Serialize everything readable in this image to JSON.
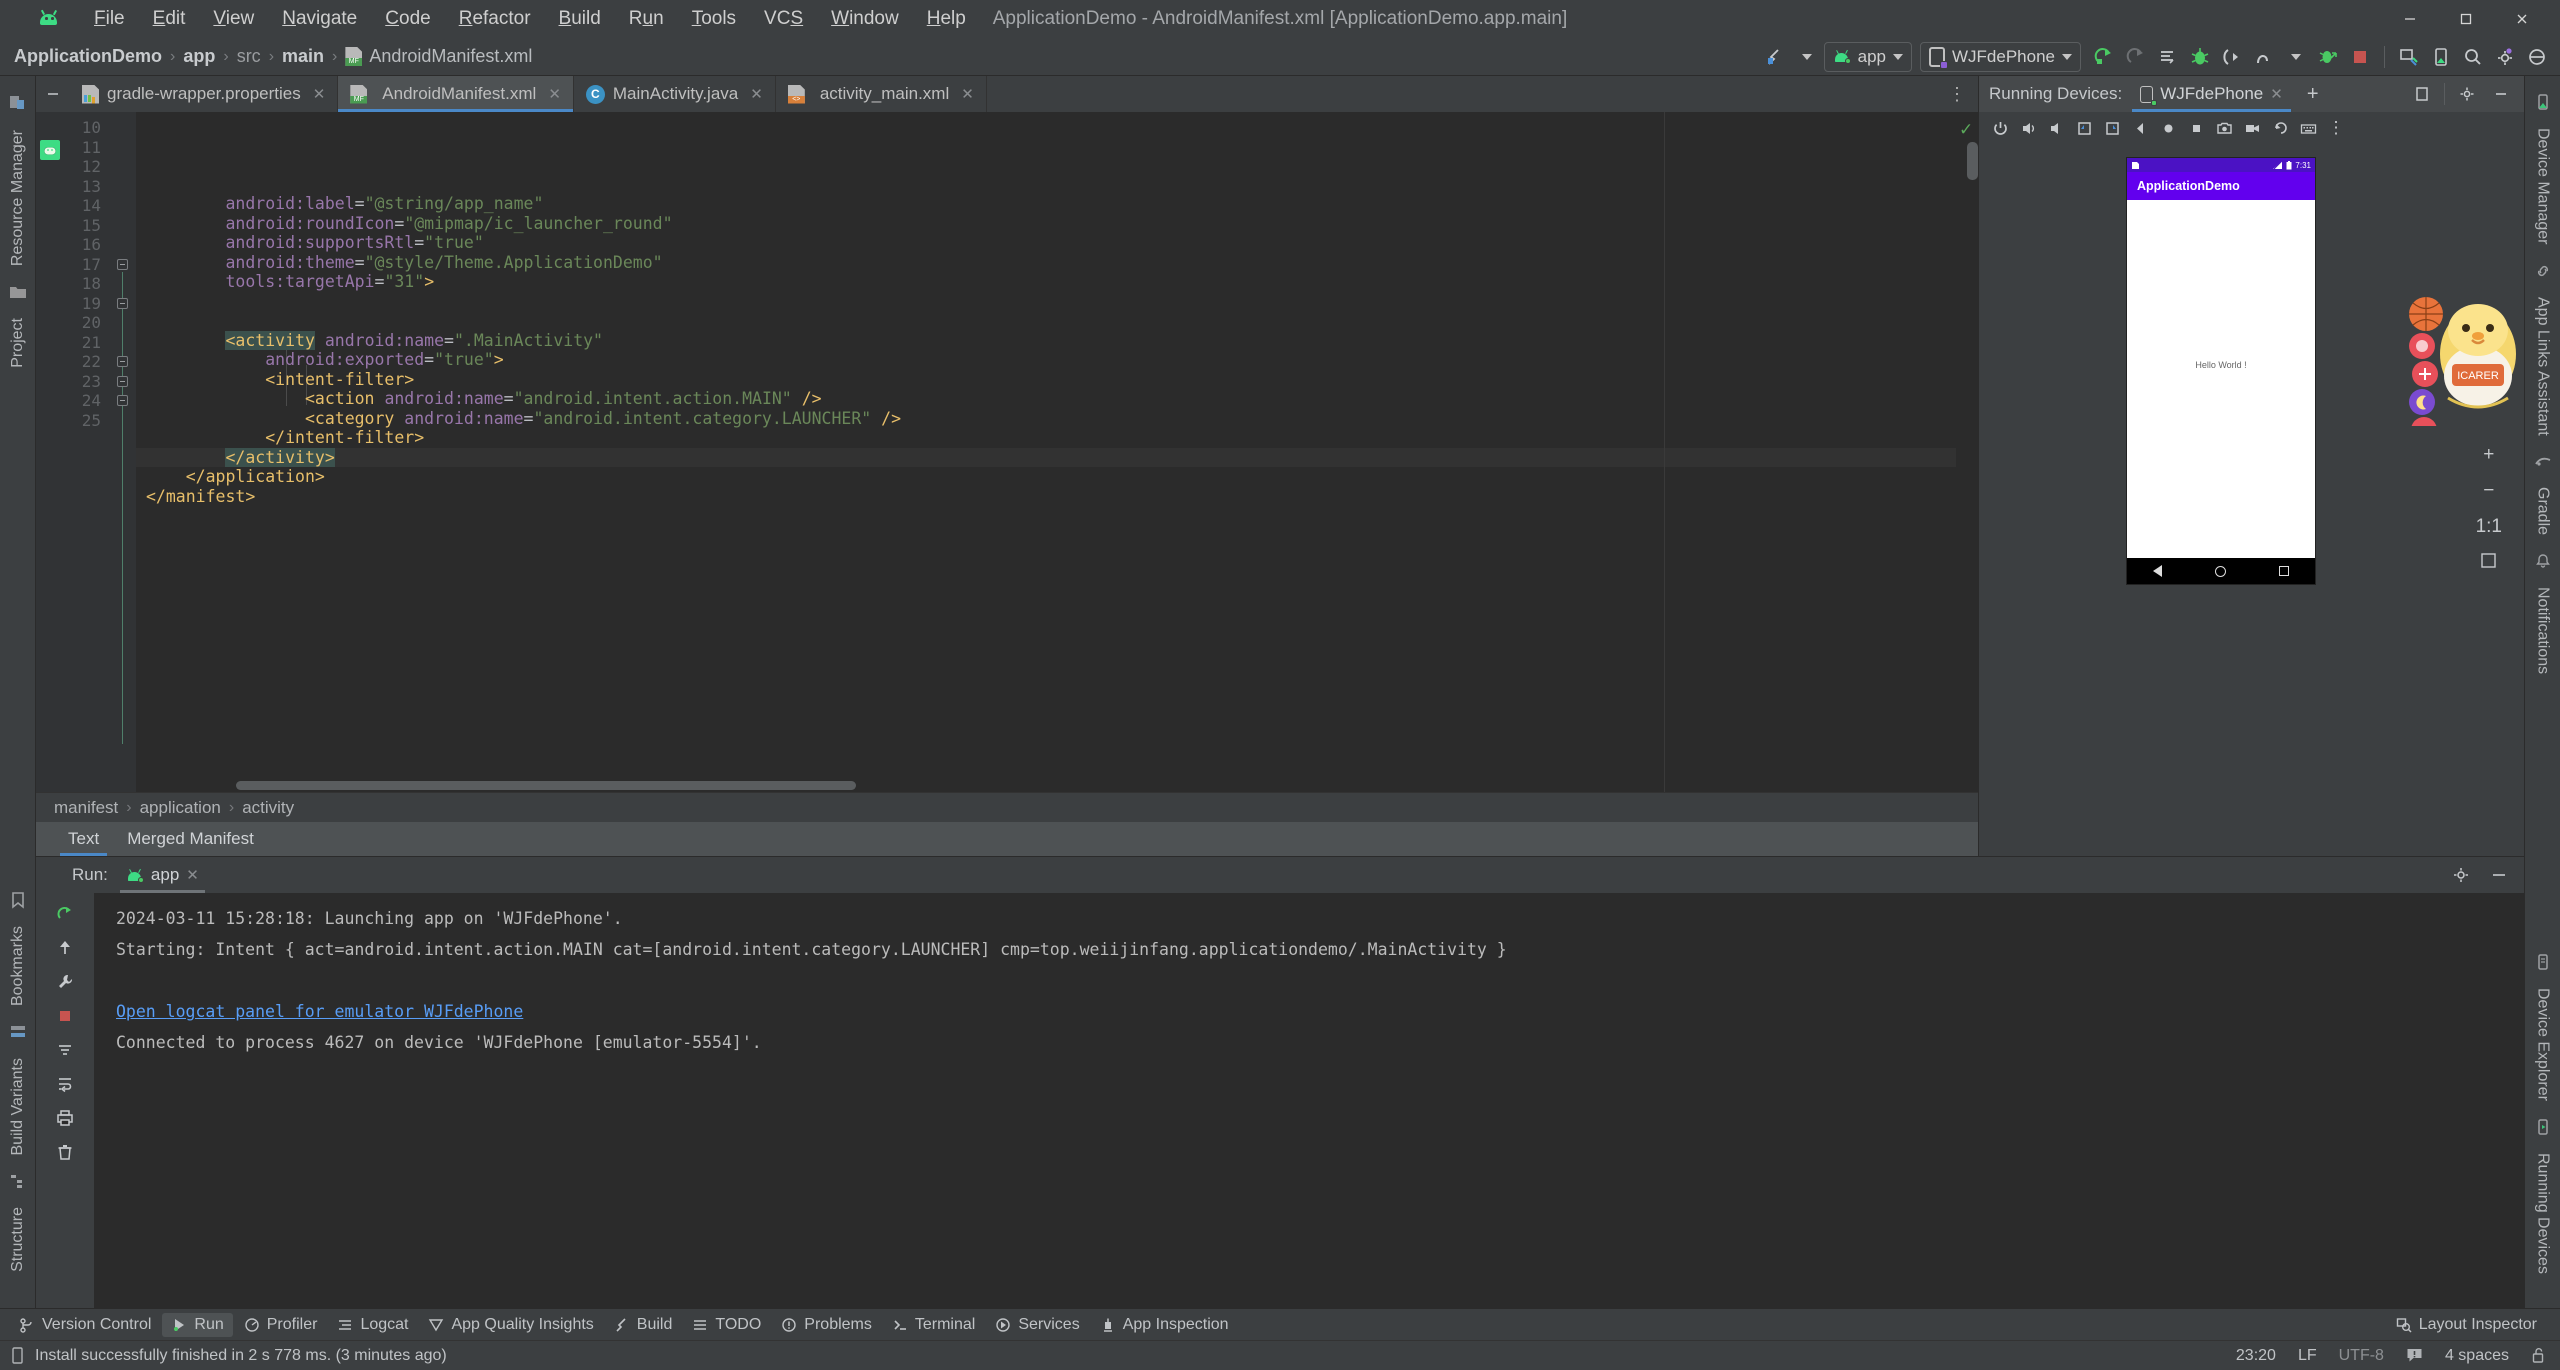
{
  "window": {
    "title": "ApplicationDemo - AndroidManifest.xml [ApplicationDemo.app.main]",
    "minimize": "—",
    "maximize": "❐",
    "close": "✕"
  },
  "menubar": {
    "items": [
      {
        "label": "File",
        "mnemonic": "F"
      },
      {
        "label": "Edit",
        "mnemonic": "E"
      },
      {
        "label": "View",
        "mnemonic": "V"
      },
      {
        "label": "Navigate",
        "mnemonic": "N"
      },
      {
        "label": "Code",
        "mnemonic": "C"
      },
      {
        "label": "Refactor",
        "mnemonic": "R"
      },
      {
        "label": "Build",
        "mnemonic": "B"
      },
      {
        "label": "Run",
        "mnemonic": "u"
      },
      {
        "label": "Tools",
        "mnemonic": "T"
      },
      {
        "label": "VCS",
        "mnemonic": "S"
      },
      {
        "label": "Window",
        "mnemonic": "W"
      },
      {
        "label": "Help",
        "mnemonic": "H"
      }
    ]
  },
  "breadcrumb": {
    "items": [
      "ApplicationDemo",
      "app",
      "src",
      "main",
      "AndroidManifest.xml"
    ],
    "separator": "›"
  },
  "toolbar": {
    "run_config": "app",
    "device": "WJFdePhone",
    "buttons": [
      "build-icon",
      "run-icon",
      "rerun-icon",
      "apply-changes-icon",
      "debug-icon",
      "attach-debugger-icon",
      "profiler-icon",
      "run-with-coverage-icon",
      "stop-icon",
      "device-manager-icon",
      "device-file-explorer-icon",
      "search-icon",
      "settings-icon",
      "account-icon"
    ]
  },
  "editor_tabs": [
    {
      "label": "gradle-wrapper.properties",
      "icon": "gradle-file-icon",
      "active": false
    },
    {
      "label": "AndroidManifest.xml",
      "icon": "manifest-file-icon",
      "active": true
    },
    {
      "label": "MainActivity.java",
      "icon": "java-class-icon",
      "active": false
    },
    {
      "label": "activity_main.xml",
      "icon": "xml-layout-icon",
      "active": false
    }
  ],
  "code": {
    "first_line_number": 10,
    "lines": [
      {
        "n": 10,
        "indent": 0,
        "partial": true,
        "segments": [
          {
            "t": "android:label",
            "c": "attr"
          },
          {
            "t": "=",
            "c": "eq"
          },
          {
            "t": "\"@string/app_name\"",
            "c": "val"
          }
        ]
      },
      {
        "n": 11,
        "indent": 0,
        "segments": [
          {
            "t": "android:roundIcon",
            "c": "attr"
          },
          {
            "t": "=",
            "c": "eq"
          },
          {
            "t": "\"@mipmap/ic_launcher_round\"",
            "c": "val"
          }
        ]
      },
      {
        "n": 12,
        "indent": 0,
        "segments": [
          {
            "t": "android:supportsRtl",
            "c": "attr"
          },
          {
            "t": "=",
            "c": "eq"
          },
          {
            "t": "\"true\"",
            "c": "val"
          }
        ]
      },
      {
        "n": 13,
        "indent": 0,
        "segments": [
          {
            "t": "android:theme",
            "c": "attr"
          },
          {
            "t": "=",
            "c": "eq"
          },
          {
            "t": "\"@style/Theme.ApplicationDemo\"",
            "c": "val"
          }
        ]
      },
      {
        "n": 14,
        "indent": 0,
        "segments": [
          {
            "t": "tools:targetApi",
            "c": "attr"
          },
          {
            "t": "=",
            "c": "eq"
          },
          {
            "t": "\"31\"",
            "c": "val"
          },
          {
            "t": ">",
            "c": "tag"
          }
        ]
      },
      {
        "n": 15,
        "indent": 0,
        "segments": []
      },
      {
        "n": 16,
        "indent": 0,
        "segments": []
      },
      {
        "n": 17,
        "indent": 0,
        "segments": [
          {
            "t": "<activity",
            "c": "tag-hl"
          },
          {
            "t": " ",
            "c": "plain"
          },
          {
            "t": "android:name",
            "c": "attr"
          },
          {
            "t": "=",
            "c": "eq"
          },
          {
            "t": "\".MainActivity\"",
            "c": "val"
          }
        ]
      },
      {
        "n": 18,
        "indent": 0,
        "segments": [
          {
            "t": "android:exported",
            "c": "attr"
          },
          {
            "t": "=",
            "c": "eq"
          },
          {
            "t": "\"true\"",
            "c": "val"
          },
          {
            "t": ">",
            "c": "tag"
          }
        ]
      },
      {
        "n": 19,
        "indent": 0,
        "segments": [
          {
            "t": "<intent-filter>",
            "c": "tag"
          }
        ]
      },
      {
        "n": 20,
        "indent": 0,
        "segments": [
          {
            "t": "<action",
            "c": "tag"
          },
          {
            "t": " ",
            "c": "plain"
          },
          {
            "t": "android:name",
            "c": "attr"
          },
          {
            "t": "=",
            "c": "eq"
          },
          {
            "t": "\"android.intent.action.MAIN\"",
            "c": "val"
          },
          {
            "t": " ",
            "c": "plain"
          },
          {
            "t": "/>",
            "c": "tag"
          }
        ]
      },
      {
        "n": 21,
        "indent": 0,
        "segments": [
          {
            "t": "<category",
            "c": "tag"
          },
          {
            "t": " ",
            "c": "plain"
          },
          {
            "t": "android:name",
            "c": "attr"
          },
          {
            "t": "=",
            "c": "eq"
          },
          {
            "t": "\"android.intent.category.LAUNCHER\"",
            "c": "val"
          },
          {
            "t": " ",
            "c": "plain"
          },
          {
            "t": "/>",
            "c": "tag"
          }
        ]
      },
      {
        "n": 22,
        "indent": 0,
        "segments": [
          {
            "t": "</intent-filter>",
            "c": "tag"
          }
        ]
      },
      {
        "n": 23,
        "indent": 0,
        "current": true,
        "segments": [
          {
            "t": "</activity>",
            "c": "tag-hl"
          }
        ]
      },
      {
        "n": 24,
        "indent": 0,
        "segments": [
          {
            "t": "</application>",
            "c": "tag"
          }
        ]
      },
      {
        "n": 25,
        "indent": 0,
        "segments": [
          {
            "t": "</manifest>",
            "c": "tag"
          }
        ]
      }
    ],
    "raw_text": [
      "        android:label=\"@string/app_name\"",
      "        android:roundIcon=\"@mipmap/ic_launcher_round\"",
      "        android:supportsRtl=\"true\"",
      "        android:theme=\"@style/Theme.ApplicationDemo\"",
      "        tools:targetApi=\"31\">",
      "",
      "",
      "        <activity android:name=\".MainActivity\"",
      "            android:exported=\"true\">",
      "            <intent-filter>",
      "                <action android:name=\"android.intent.action.MAIN\" />",
      "                <category android:name=\"android.intent.category.LAUNCHER\" />",
      "            </intent-filter>",
      "        </activity>",
      "    </application>",
      "</manifest>"
    ]
  },
  "editor_breadcrumb": {
    "items": [
      "manifest",
      "application",
      "activity"
    ],
    "separator": "›"
  },
  "design_tabs": [
    {
      "label": "Text",
      "active": true
    },
    {
      "label": "Merged Manifest",
      "active": false
    }
  ],
  "device_panel": {
    "title": "Running Devices:",
    "tab": "WJFdePhone",
    "add_tab": "+",
    "toolbar_icons": [
      "power-icon",
      "volume-up-icon",
      "volume-down-icon",
      "rotate-left-icon",
      "rotate-right-icon",
      "back-icon",
      "home-icon",
      "overview-icon",
      "screenshot-icon",
      "record-icon",
      "undo-icon",
      "keyboard-icon",
      "more-icon"
    ],
    "header_icons": [
      "split-window-icon",
      "settings-icon",
      "minimize-icon"
    ],
    "emulator": {
      "status_time": "7:31",
      "app_title": "ApplicationDemo",
      "body_text": "Hello World !",
      "appbar_color": "#6200EE",
      "nav_buttons": [
        "back-nav-icon",
        "home-nav-icon",
        "recents-nav-icon"
      ]
    },
    "zoom_controls": {
      "zoom_in": "+",
      "zoom_out": "−",
      "zoom_level": "1:1",
      "fit_label": "fit-to-screen-icon"
    }
  },
  "run_panel": {
    "label": "Run:",
    "tab": "app",
    "console_lines": [
      {
        "text": "2024-03-11 15:28:18: Launching app on 'WJFdePhone'.",
        "link": false
      },
      {
        "text": "Starting: Intent { act=android.intent.action.MAIN cat=[android.intent.category.LAUNCHER] cmp=top.weiijinfang.applicationdemo/.MainActivity }",
        "link": false
      },
      {
        "text": "",
        "link": false
      },
      {
        "text": "Open logcat panel for emulator WJFdePhone",
        "link": true
      },
      {
        "text": "Connected to process 4627 on device 'WJFdePhone [emulator-5554]'.",
        "link": false
      }
    ],
    "side_icons": [
      "rerun-icon",
      "up-arrow-icon",
      "wrench-icon",
      "stop-icon",
      "filter-icon",
      "soft-wrap-icon",
      "print-icon",
      "trash-icon"
    ],
    "header_icons": [
      "settings-icon",
      "minimize-icon"
    ]
  },
  "left_strip": {
    "items": [
      {
        "label": "Resource Manager",
        "icon": "resource-manager-icon"
      },
      {
        "label": "Project",
        "icon": "project-icon"
      },
      {
        "label": "Bookmarks",
        "icon": "bookmarks-icon"
      },
      {
        "label": "Build Variants",
        "icon": "build-variants-icon"
      },
      {
        "label": "Structure",
        "icon": "structure-icon"
      }
    ]
  },
  "right_strip": {
    "items": [
      {
        "label": "Device Manager",
        "icon": "device-manager-icon"
      },
      {
        "label": "App Links Assistant",
        "icon": "app-links-icon"
      },
      {
        "label": "Gradle",
        "icon": "gradle-icon"
      },
      {
        "label": "Notifications",
        "icon": "notifications-icon"
      },
      {
        "label": "Device Explorer",
        "icon": "device-explorer-icon"
      },
      {
        "label": "Running Devices",
        "icon": "running-devices-icon"
      }
    ]
  },
  "bottom_bar": {
    "items": [
      {
        "label": "Version Control",
        "icon": "version-control-icon",
        "active": false
      },
      {
        "label": "Run",
        "icon": "run-icon",
        "active": true
      },
      {
        "label": "Profiler",
        "icon": "profiler-icon",
        "active": false
      },
      {
        "label": "Logcat",
        "icon": "logcat-icon",
        "active": false
      },
      {
        "label": "App Quality Insights",
        "icon": "app-quality-icon",
        "active": false
      },
      {
        "label": "Build",
        "icon": "build-icon",
        "active": false
      },
      {
        "label": "TODO",
        "icon": "todo-icon",
        "active": false
      },
      {
        "label": "Problems",
        "icon": "problems-icon",
        "active": false
      },
      {
        "label": "Terminal",
        "icon": "terminal-icon",
        "active": false
      },
      {
        "label": "Services",
        "icon": "services-icon",
        "active": false
      },
      {
        "label": "App Inspection",
        "icon": "app-inspection-icon",
        "active": false
      }
    ],
    "right_item": {
      "label": "Layout Inspector",
      "icon": "layout-inspector-icon"
    }
  },
  "status_bar": {
    "message": "Install successfully finished in 2 s 778 ms. (3 minutes ago)",
    "message_icon": "device-icon",
    "time": "23:20",
    "line_separator": "LF",
    "encoding": "UTF-8",
    "problems_icon": "problems-badge-icon",
    "indent": "4 spaces",
    "lock_icon": "unlock-icon"
  },
  "colors": {
    "accent_blue": "#4a88e8",
    "android_green": "#3ddc84",
    "app_purple": "#6200EE",
    "link_blue": "#589df6",
    "tag_yellow": "#e8bf6a",
    "attr_purple": "#9876aa",
    "string_green": "#6a8759",
    "stop_red": "#c75450"
  }
}
